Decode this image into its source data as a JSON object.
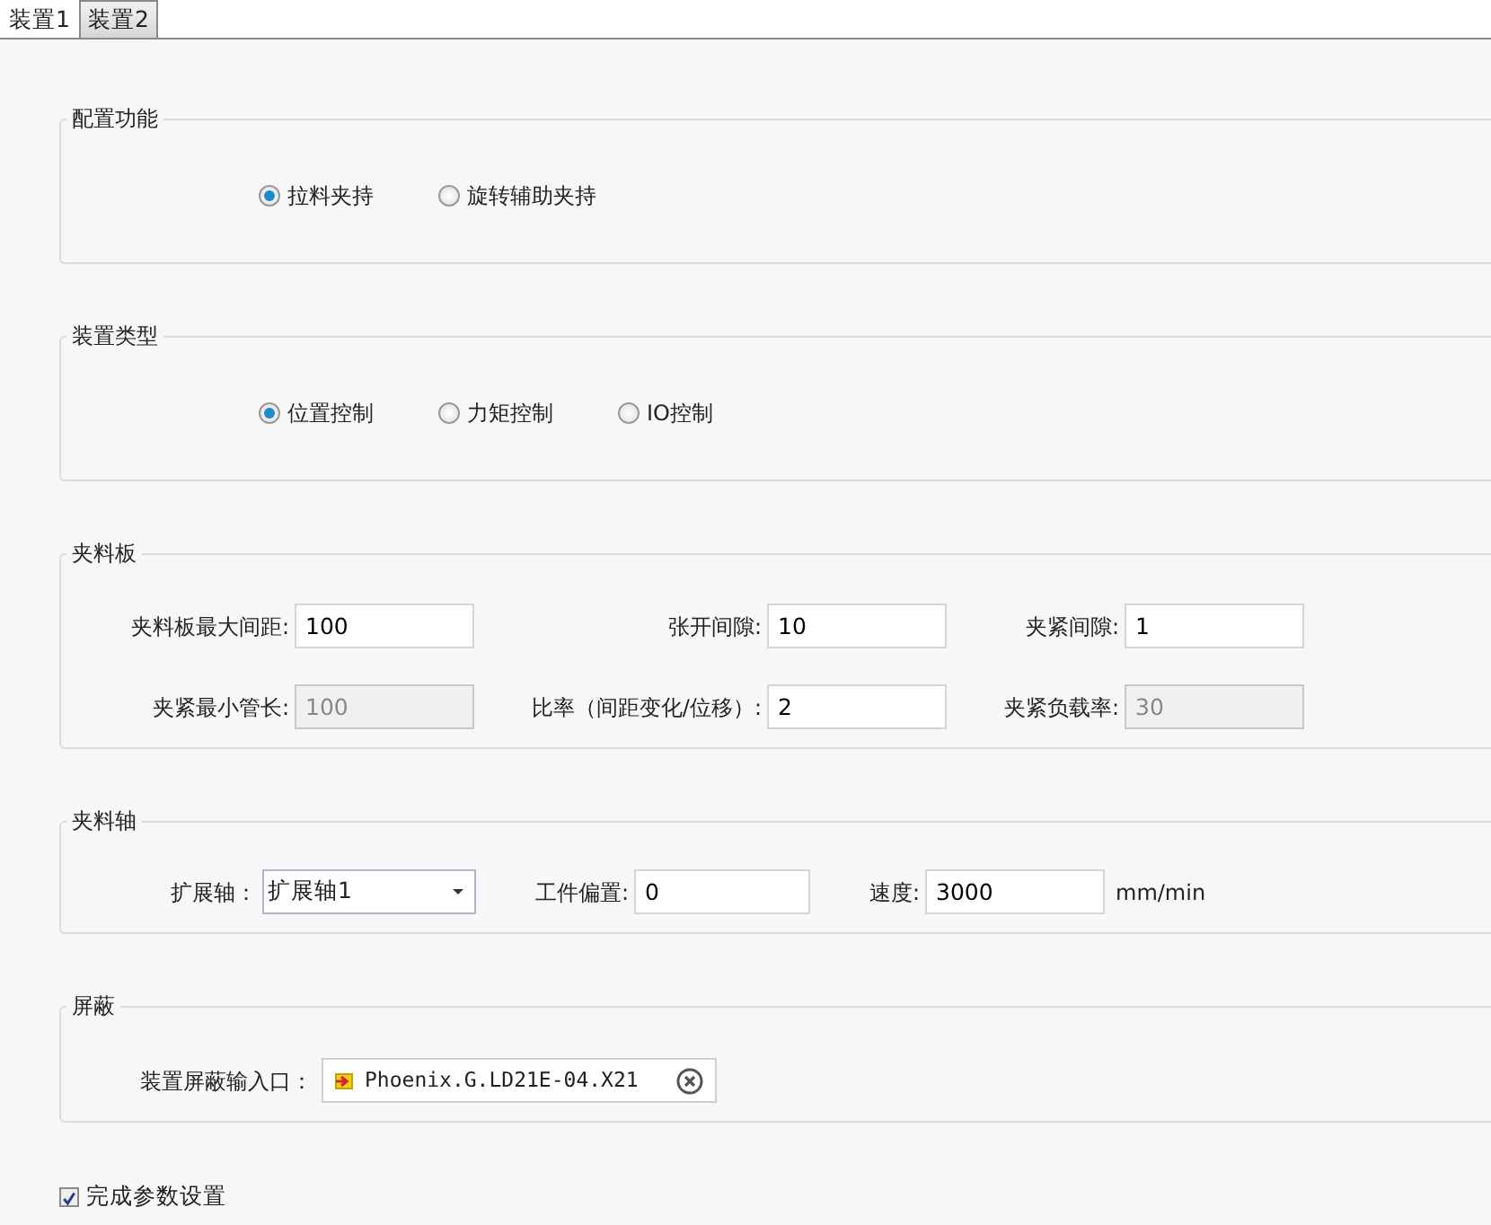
{
  "tabs": [
    {
      "label": "装置1",
      "selected": true
    },
    {
      "label": "装置2",
      "selected": false
    }
  ],
  "sections": [
    {
      "title": "配置功能",
      "kind": "radios",
      "options": [
        {
          "label": "拉料夹持",
          "selected": true
        },
        {
          "label": "旋转辅助夹持",
          "selected": false
        }
      ]
    },
    {
      "title": "装置类型",
      "kind": "radios",
      "options": [
        {
          "label": "位置控制",
          "selected": true
        },
        {
          "label": "力矩控制",
          "selected": false
        },
        {
          "label": "IO控制",
          "selected": false
        }
      ]
    },
    {
      "title": "夹料板",
      "kind": "plate",
      "fields": [
        {
          "kind": "text",
          "label": "夹料板最大间距:",
          "value": "100",
          "disabled": false
        },
        {
          "kind": "text",
          "label": "张开间隙:",
          "value": "10",
          "disabled": false
        },
        {
          "kind": "text",
          "label": "夹紧间隙:",
          "value": "1",
          "disabled": false
        },
        {
          "kind": "text",
          "label": "夹紧最小管长:",
          "value": "100",
          "disabled": true
        },
        {
          "kind": "text",
          "label": "比率（间距变化/位移）:",
          "value": "2",
          "disabled": false
        },
        {
          "kind": "text",
          "label": "夹紧负载率:",
          "value": "30",
          "disabled": true
        }
      ]
    },
    {
      "title": "夹料轴",
      "kind": "axis",
      "fields": [
        {
          "kind": "select",
          "label": "扩展轴：",
          "value": "扩展轴1"
        },
        {
          "kind": "text",
          "label": "工件偏置:",
          "value": "0",
          "disabled": false
        },
        {
          "kind": "text",
          "label": "速度:",
          "value": "3000",
          "disabled": false,
          "unit": "mm/min"
        }
      ]
    },
    {
      "title": "屏蔽",
      "kind": "shield",
      "fields": [
        {
          "kind": "tag",
          "label": "装置屏蔽输入口：",
          "value": "Phoenix.G.LD21E-04.X21"
        }
      ]
    }
  ],
  "finish": {
    "label": "完成参数设置",
    "checked": true
  }
}
